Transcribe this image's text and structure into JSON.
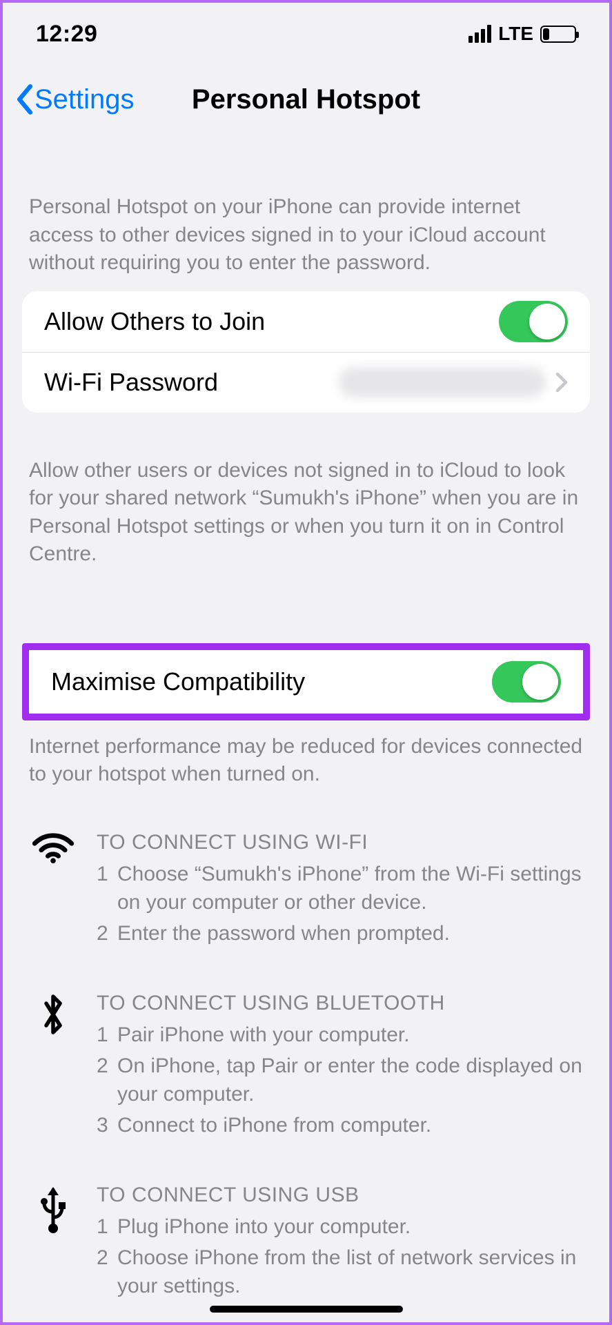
{
  "status": {
    "time": "12:29",
    "network": "LTE"
  },
  "nav": {
    "back_label": "Settings",
    "title": "Personal Hotspot"
  },
  "intro_text": "Personal Hotspot on your iPhone can provide internet access to other devices signed in to your iCloud account without requiring you to enter the password.",
  "group1": {
    "allow_label": "Allow Others to Join",
    "allow_on": true,
    "wifi_pw_label": "Wi-Fi Password"
  },
  "allow_footer": "Allow other users or devices not signed in to iCloud to look for your shared network “Sumukh's iPhone” when you are in Personal Hotspot settings or when you turn it on in Control Centre.",
  "group2": {
    "max_compat_label": "Maximise Compatibility",
    "max_compat_on": true
  },
  "max_compat_footer": "Internet performance may be reduced for devices connected to your hotspot when turned on.",
  "instructions": {
    "wifi": {
      "title": "TO CONNECT USING WI-FI",
      "steps": [
        "Choose “Sumukh's iPhone” from the Wi-Fi settings on your computer or other device.",
        "Enter the password when prompted."
      ]
    },
    "bluetooth": {
      "title": "TO CONNECT USING BLUETOOTH",
      "steps": [
        "Pair iPhone with your computer.",
        "On iPhone, tap Pair or enter the code displayed on your computer.",
        "Connect to iPhone from computer."
      ]
    },
    "usb": {
      "title": "TO CONNECT USING USB",
      "steps": [
        "Plug iPhone into your computer.",
        "Choose iPhone from the list of network services in your settings."
      ]
    }
  }
}
